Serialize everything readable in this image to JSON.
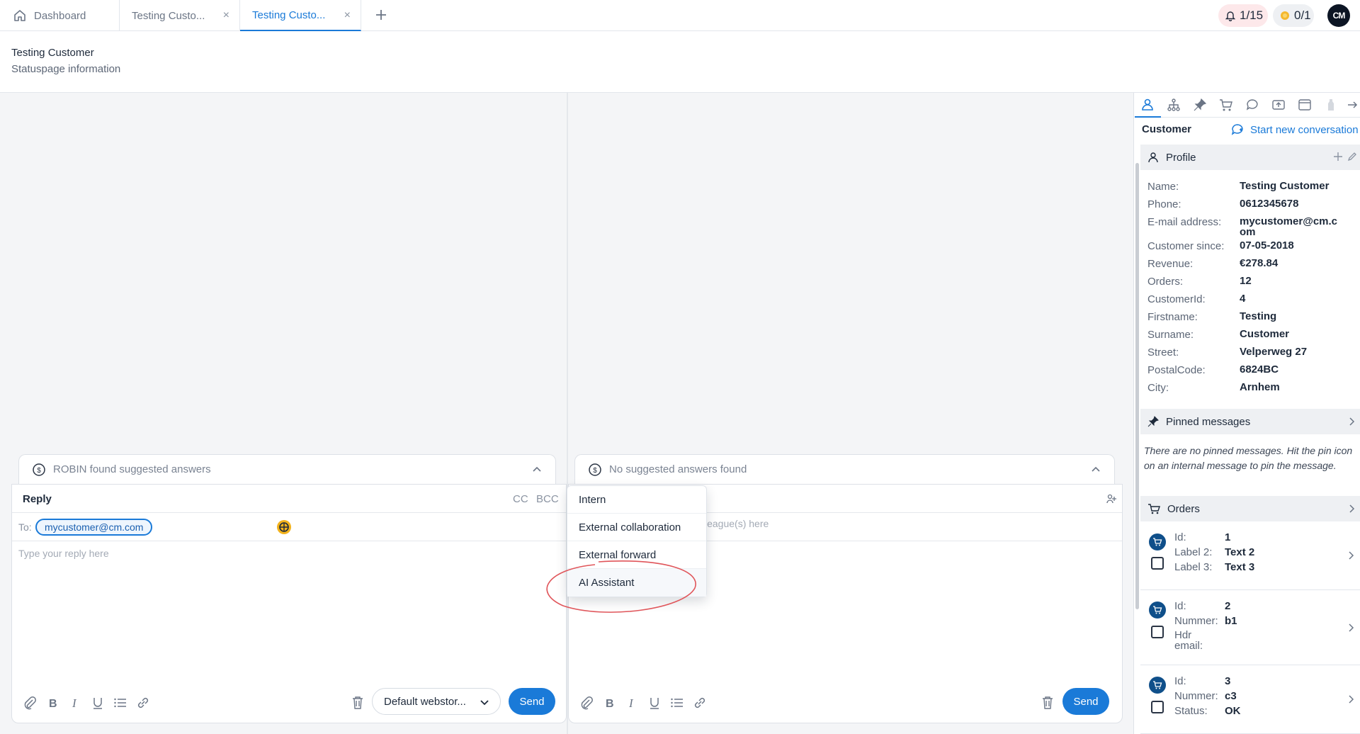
{
  "tabs": [
    {
      "label": "Dashboard",
      "icon": "home-icon"
    },
    {
      "label": "Testing Custo...",
      "close": "×"
    },
    {
      "label": "Testing Custo...",
      "close": "×",
      "active": true
    }
  ],
  "notifications": {
    "bell_count": "1/15",
    "slot_count": "0/1"
  },
  "avatar_text": "CM",
  "page": {
    "title": "Testing Customer",
    "subtitle": "Statuspage information"
  },
  "left_pane": {
    "suggest_text": "ROBIN found suggested answers",
    "reply_label": "Reply",
    "cc": "CC",
    "bcc": "BCC",
    "to_label": "To:",
    "to_chip": "mycustomer@cm.com",
    "placeholder": "Type your reply here",
    "template_select": "Default webstor...",
    "send_label": "Send"
  },
  "right_pane": {
    "suggest_text": "No suggested answers found",
    "colleague_placeholder": "league(s) here",
    "send_label": "Send"
  },
  "menu": {
    "items": [
      "Intern",
      "External collaboration",
      "External forward",
      "AI Assistant"
    ]
  },
  "sidebar": {
    "customer_label": "Customer",
    "start_conversation": "Start new conversation",
    "profile": {
      "title": "Profile",
      "fields": [
        {
          "key": "Name:",
          "value": "Testing Customer"
        },
        {
          "key": "Phone:",
          "value": "0612345678"
        },
        {
          "key": "E-mail address:",
          "value": "mycustomer@cm.com"
        },
        {
          "key": "Customer since:",
          "value": "07-05-2018"
        },
        {
          "key": "Revenue:",
          "value": "€278.84"
        },
        {
          "key": "Orders:",
          "value": "12"
        },
        {
          "key": "CustomerId:",
          "value": "4"
        },
        {
          "key": "Firstname:",
          "value": "Testing"
        },
        {
          "key": "Surname:",
          "value": "Customer"
        },
        {
          "key": "Street:",
          "value": "Velperweg 27"
        },
        {
          "key": "PostalCode:",
          "value": "6824BC"
        },
        {
          "key": "City:",
          "value": "Arnhem"
        }
      ]
    },
    "pinned": {
      "title": "Pinned messages",
      "empty_text": "There are no pinned messages. Hit the pin icon on an internal message to pin the message."
    },
    "orders": {
      "title": "Orders",
      "items": [
        {
          "rows": [
            {
              "k": "Id:",
              "v": "1"
            },
            {
              "k": "Label 2:",
              "v": "Text 2"
            },
            {
              "k": "Label 3:",
              "v": "Text 3"
            }
          ]
        },
        {
          "rows": [
            {
              "k": "Id:",
              "v": "2"
            },
            {
              "k": "Nummer:",
              "v": "b1"
            },
            {
              "k": "Hdr email:",
              "v": ""
            }
          ]
        },
        {
          "rows": [
            {
              "k": "Id:",
              "v": "3"
            },
            {
              "k": "Nummer:",
              "v": "c3"
            },
            {
              "k": "Status:",
              "v": "OK"
            }
          ]
        }
      ]
    }
  },
  "colors": {
    "accent": "#1a7ad8",
    "badge_bell": "#fde8ea",
    "annotation": "#e0555a",
    "order_icon": "#0f4f8a"
  }
}
